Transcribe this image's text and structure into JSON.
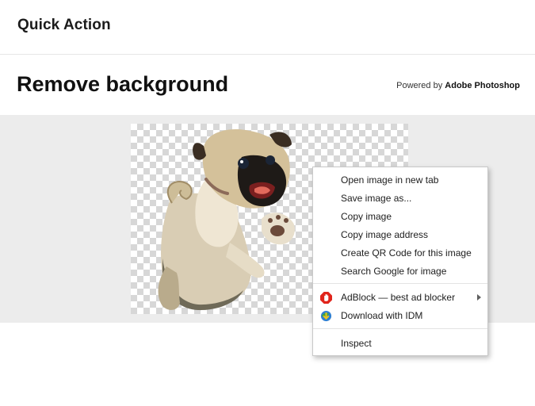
{
  "app": {
    "title": "Quick Action"
  },
  "page": {
    "heading": "Remove background",
    "powered_prefix": "Powered by",
    "powered_brand": "Adobe Photoshop"
  },
  "preview": {
    "image_alt": "pug image with background removed"
  },
  "context_menu": {
    "items": [
      {
        "label": "Open image in new tab"
      },
      {
        "label": "Save image as..."
      },
      {
        "label": "Copy image"
      },
      {
        "label": "Copy image address"
      },
      {
        "label": "Create QR Code for this image"
      },
      {
        "label": "Search Google for image"
      },
      {
        "label": "AdBlock — best ad blocker",
        "icon": "adblock-icon",
        "has_submenu": true
      },
      {
        "label": "Download with IDM",
        "icon": "idm-icon"
      },
      {
        "label": "Inspect"
      }
    ]
  },
  "colors": {
    "adblock_red": "#e0241b",
    "checker_dark": "#d7d7d7",
    "preview_bg": "#ececec"
  }
}
